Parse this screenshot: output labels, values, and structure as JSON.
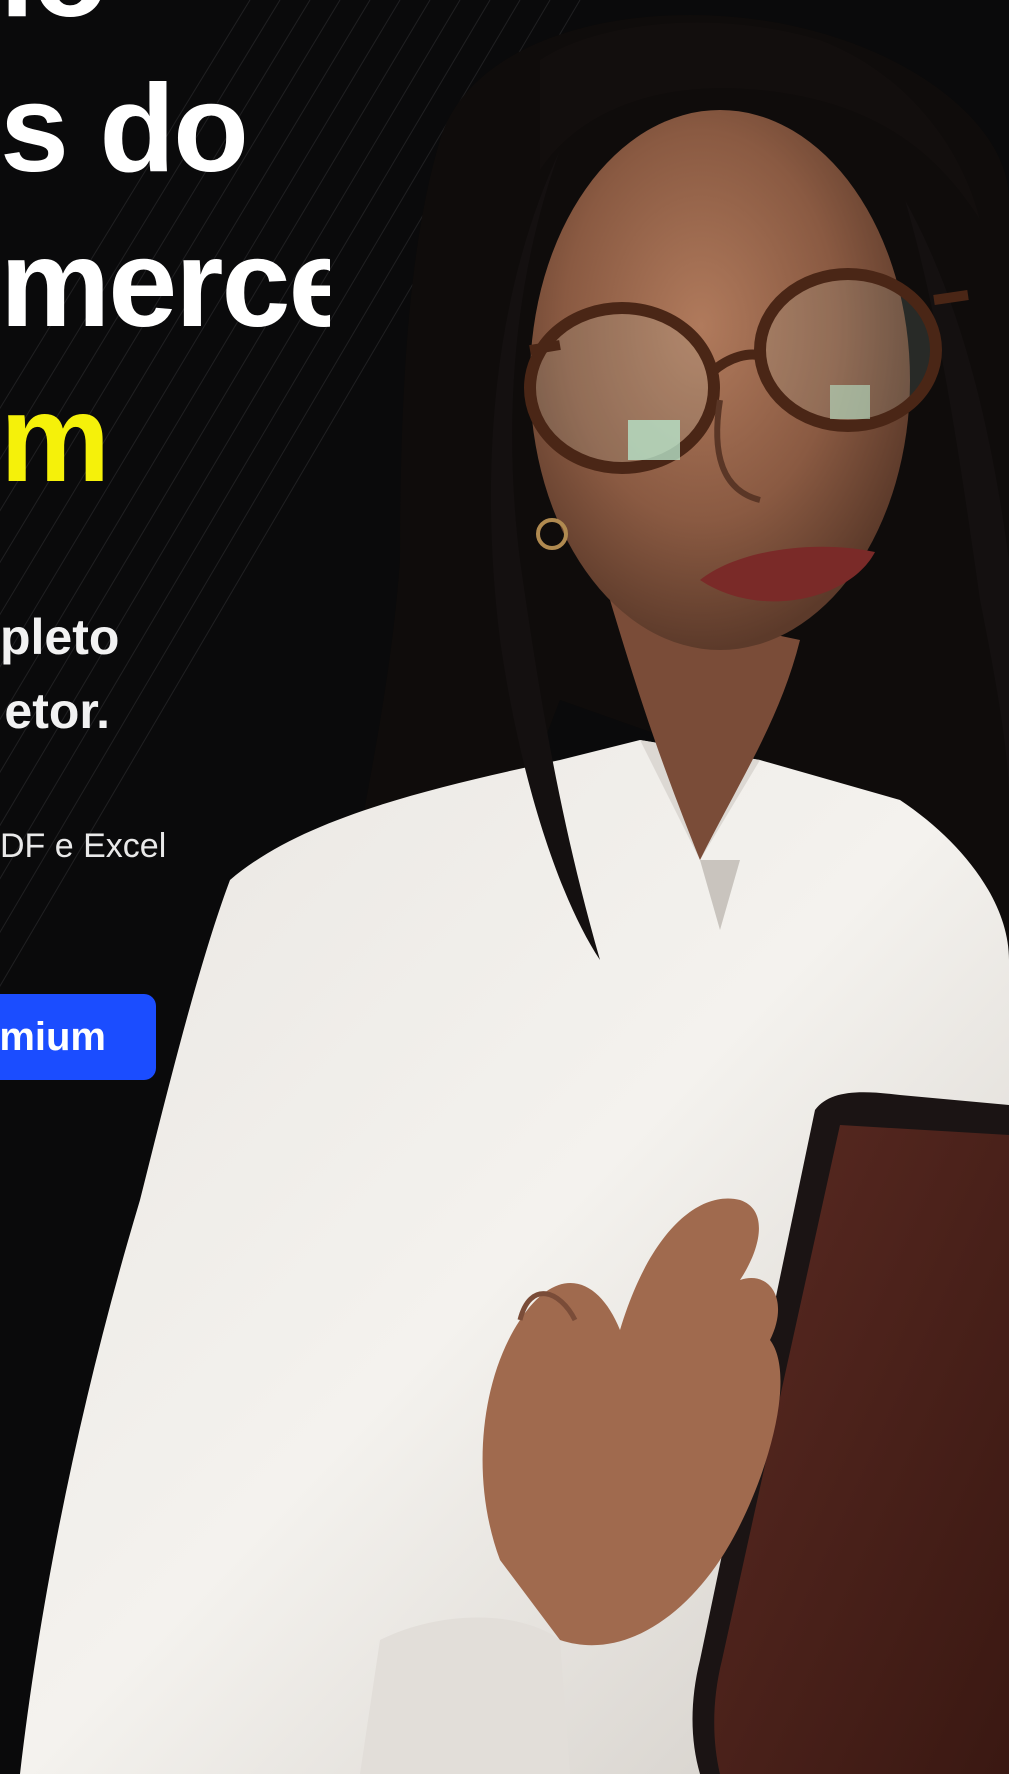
{
  "hero": {
    "headline": {
      "line1": "io",
      "line2": "s do",
      "line3": "merce",
      "line4": "m"
    },
    "subhead": {
      "line1": "pleto",
      "line2": "etor."
    },
    "formats_text": "DF e Excel",
    "cta_label": "mium",
    "colors": {
      "background": "#0a0a0b",
      "headline": "#ffffff",
      "highlight": "#f5f10a",
      "cta_background": "#1b4dff"
    }
  },
  "image": {
    "subject": "woman-with-glasses-using-tablet"
  }
}
